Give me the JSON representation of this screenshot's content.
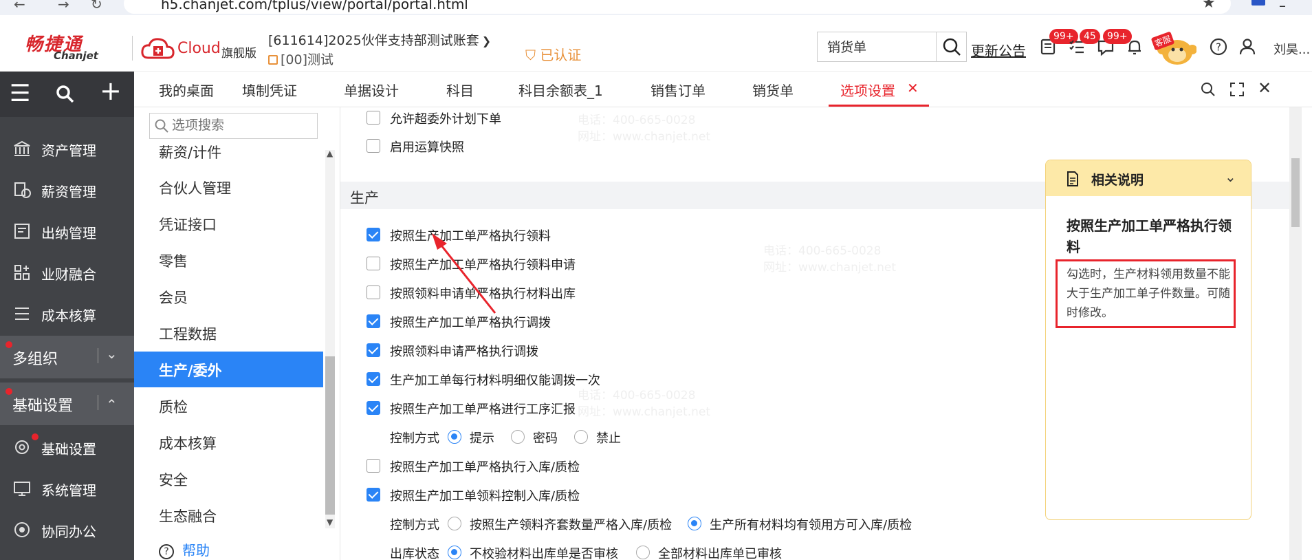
{
  "browser": {
    "url": "h5.chanjet.com/tplus/view/portal/portal.html"
  },
  "header": {
    "logo_cn": "畅捷通",
    "logo_en": "Chanjet",
    "cloud_text": "Cloud",
    "edition": "旗舰版",
    "account": "[611614]2025伙伴支持部测试账套",
    "company": "[00]测试",
    "verified": "已认证",
    "search_value": "销货单",
    "notice": "更新公告",
    "badges": {
      "tasks": "99+",
      "todo": "45",
      "messages": "99+"
    },
    "kefu": "客服",
    "username": "刘昊..."
  },
  "leftnav": {
    "items": [
      {
        "label": "资产管理",
        "icon": "bank-icon"
      },
      {
        "label": "薪资管理",
        "icon": "salary-icon"
      },
      {
        "label": "出纳管理",
        "icon": "cashier-icon"
      },
      {
        "label": "业财融合",
        "icon": "fusion-icon"
      },
      {
        "label": "成本核算",
        "icon": "list-icon"
      }
    ],
    "group1": "多组织",
    "group2": "基础设置",
    "items2": [
      {
        "label": "基础设置",
        "icon": "settings-icon"
      },
      {
        "label": "系统管理",
        "icon": "system-icon"
      },
      {
        "label": "协同办公",
        "icon": "collab-icon"
      }
    ]
  },
  "tabs": [
    {
      "label": "我的桌面"
    },
    {
      "label": "填制凭证"
    },
    {
      "label": "单据设计"
    },
    {
      "label": "科目"
    },
    {
      "label": "科目余额表_1"
    },
    {
      "label": "销售订单"
    },
    {
      "label": "销货单"
    },
    {
      "label": "选项设置",
      "active": true
    }
  ],
  "options_sidebar": {
    "search_placeholder": "选项搜索",
    "items": [
      {
        "label": "薪资/计件"
      },
      {
        "label": "合伙人管理"
      },
      {
        "label": "凭证接口"
      },
      {
        "label": "零售"
      },
      {
        "label": "会员"
      },
      {
        "label": "工程数据"
      },
      {
        "label": "生产/委外",
        "active": true
      },
      {
        "label": "质检"
      },
      {
        "label": "成本核算"
      },
      {
        "label": "安全"
      },
      {
        "label": "生态融合"
      }
    ],
    "help": "帮助"
  },
  "main": {
    "top_options": [
      {
        "label": "允许超委外计划下单",
        "checked": false
      },
      {
        "label": "启用运算快照",
        "checked": false
      }
    ],
    "section": "生产",
    "options": [
      {
        "label": "按照生产加工单严格执行领料",
        "checked": true
      },
      {
        "label": "按照生产加工单严格执行领料申请",
        "checked": false
      },
      {
        "label": "按照领料申请单严格执行材料出库",
        "checked": false
      },
      {
        "label": "按照生产加工单严格执行调拨",
        "checked": true
      },
      {
        "label": "按照领料申请严格执行调拨",
        "checked": true
      },
      {
        "label": "生产加工单每行材料明细仅能调拨一次",
        "checked": true
      },
      {
        "label": "按照生产加工单严格进行工序汇报",
        "checked": true
      }
    ],
    "control_mode_1": {
      "label": "控制方式",
      "options": [
        "提示",
        "密码",
        "禁止"
      ],
      "selected": 0
    },
    "options2": [
      {
        "label": "按照生产加工单严格执行入库/质检",
        "checked": false
      },
      {
        "label": "按照生产加工单领料控制入库/质检",
        "checked": true
      }
    ],
    "control_mode_2": {
      "label": "控制方式",
      "options": [
        "按照生产领料齐套数量严格入库/质检",
        "生产所有材料均有领用方可入库/质检"
      ],
      "selected": 1
    },
    "outbound_status": {
      "label": "出库状态",
      "options": [
        "不校验材料出库单是否审核",
        "全部材料出库单已审核"
      ],
      "selected": 0
    }
  },
  "explain": {
    "header": "相关说明",
    "title": "按照生产加工单严格执行领料",
    "body": "勾选时，生产材料领用数量不能大于生产加工单子件数量。可随时修改。"
  },
  "watermark": {
    "phone": "电话：400-665-0028",
    "site": "网址：www.chanjet.net"
  },
  "colors": {
    "accent": "#2a84f6",
    "brand_red": "#d8262c",
    "nav_bg": "#414347",
    "panel_head": "#fde9a8"
  }
}
